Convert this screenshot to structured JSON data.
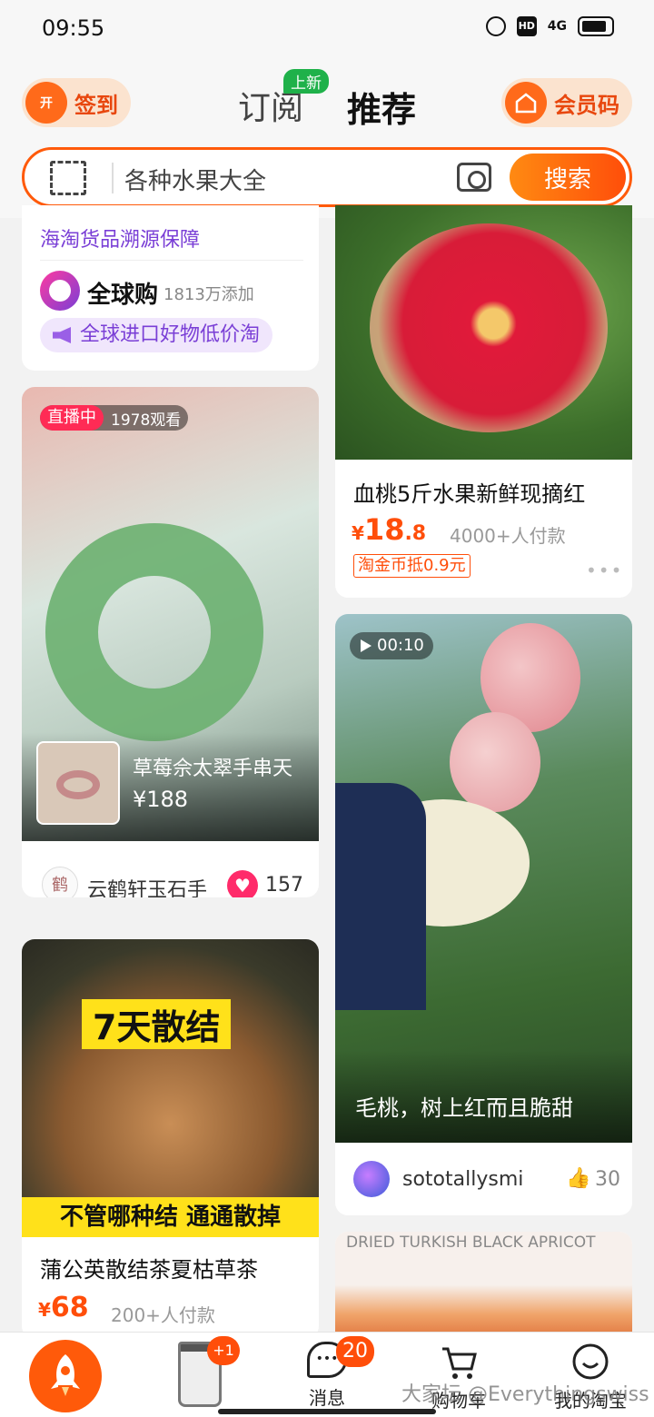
{
  "status": {
    "time": "09:55",
    "hd": "HD",
    "network": "4G"
  },
  "header": {
    "checkin": "签到",
    "checkin_icon_text": "开",
    "tab_subscribe": "订阅",
    "new_badge": "上新",
    "tab_recommend": "推荐",
    "member_code": "会员码"
  },
  "search": {
    "placeholder": "各种水果大全",
    "button": "搜索"
  },
  "global": {
    "tagline": "海淘货品溯源保障",
    "name": "全球购",
    "count": "1813万添加",
    "promo": "全球进口好物低价淘"
  },
  "live": {
    "badge": "直播中",
    "viewers": "1978观看",
    "product": "草莓佘太翠手串天",
    "price": "¥188",
    "seller": "云鹤轩玉石手",
    "likes": "157"
  },
  "tea": {
    "banner_top": "7天散结",
    "banner_bottom": "不管哪种结 通通散掉",
    "title": "蒲公英散结茶夏枯草茶",
    "price_symbol": "¥",
    "price": "68",
    "sold": "200+人付款"
  },
  "peach": {
    "title": "血桃5斤水果新鲜现摘红",
    "price_symbol": "¥",
    "price_int": "18",
    "price_dec": ".8",
    "sold": "4000+人付款",
    "coupon": "淘金币抵0.9元"
  },
  "video": {
    "duration": "00:10",
    "caption": "毛桃，树上红而且脆甜",
    "user": "sototallysmi",
    "likes": "30"
  },
  "apricot": {
    "caption": "DRIED TURKISH BLACK APRICOT"
  },
  "tabbar": {
    "cart_badge": "+1",
    "message_count": "20",
    "message": "消息",
    "cart": "购物车",
    "mine": "我的淘宝",
    "watermark": "大家坛 @Everythingswiss"
  }
}
